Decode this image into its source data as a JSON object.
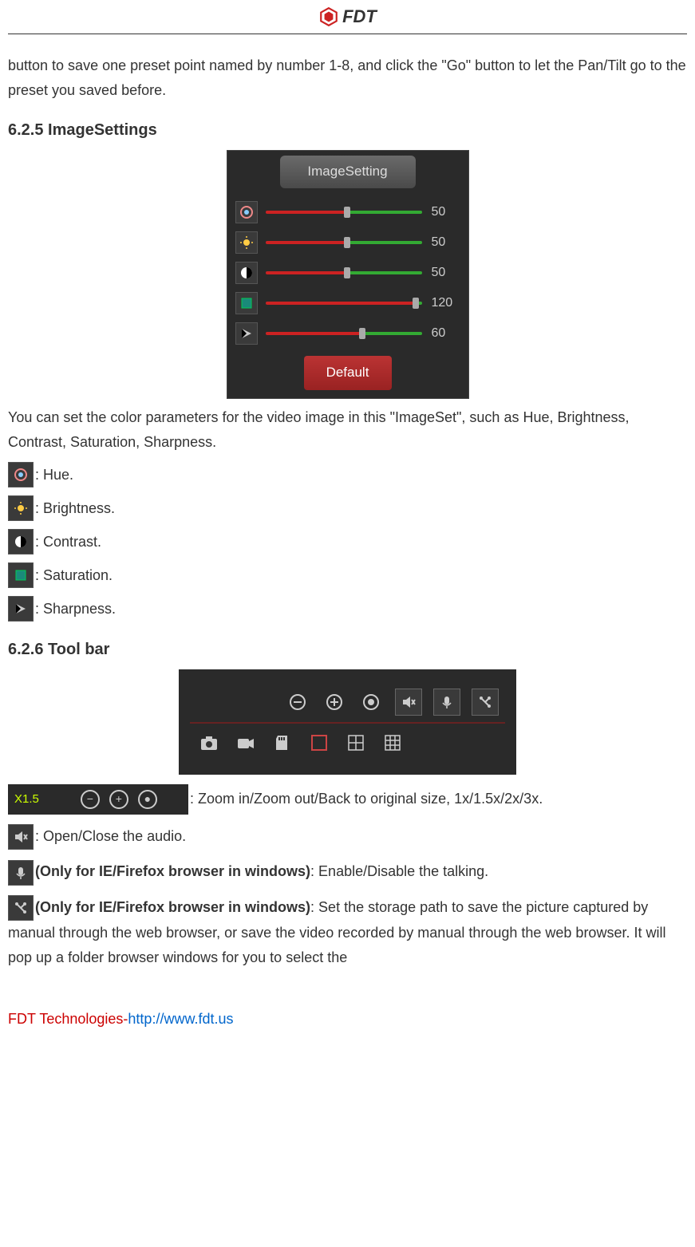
{
  "header": {
    "logo_text": "FDT"
  },
  "intro_paragraph": "button to save one preset point named by number 1-8, and click the \"Go\" button to let the Pan/Tilt go to the preset you saved before.",
  "section_625": {
    "title": "6.2.5 ImageSettings",
    "panel": {
      "tab_label": "ImageSetting",
      "sliders": [
        {
          "value": "50",
          "thumb_pct": 50
        },
        {
          "value": "50",
          "thumb_pct": 50
        },
        {
          "value": "50",
          "thumb_pct": 50
        },
        {
          "value": "120",
          "thumb_pct": 94
        },
        {
          "value": "60",
          "thumb_pct": 60
        }
      ],
      "default_button": "Default"
    },
    "description": "You can set the color parameters for the video image in this \"ImageSet\", such as Hue, Brightness, Contrast, Saturation, Sharpness.",
    "icon_labels": [
      {
        "label": ": Hue."
      },
      {
        "label": ": Brightness."
      },
      {
        "label": ": Contrast."
      },
      {
        "label": ": Saturation."
      },
      {
        "label": ": Sharpness."
      }
    ]
  },
  "section_626": {
    "title": "6.2.6 Tool bar",
    "zoom": {
      "label": "X1.5",
      "description": ": Zoom in/Zoom out/Back to original size, 1x/1.5x/2x/3x."
    },
    "audio": {
      "description": ": Open/Close the audio."
    },
    "talk": {
      "bold": "(Only for IE/Firefox browser in windows)",
      "description": ": Enable/Disable the talking."
    },
    "storage": {
      "bold": "(Only for IE/Firefox browser in windows)",
      "description": ": Set the storage path to save the picture captured by manual through the web browser, or save the video recorded by manual through the web browser. It will pop up a folder browser windows for you to select the"
    }
  },
  "footer": {
    "company": "FDT Technologies-",
    "url": "http://www.fdt.us"
  }
}
